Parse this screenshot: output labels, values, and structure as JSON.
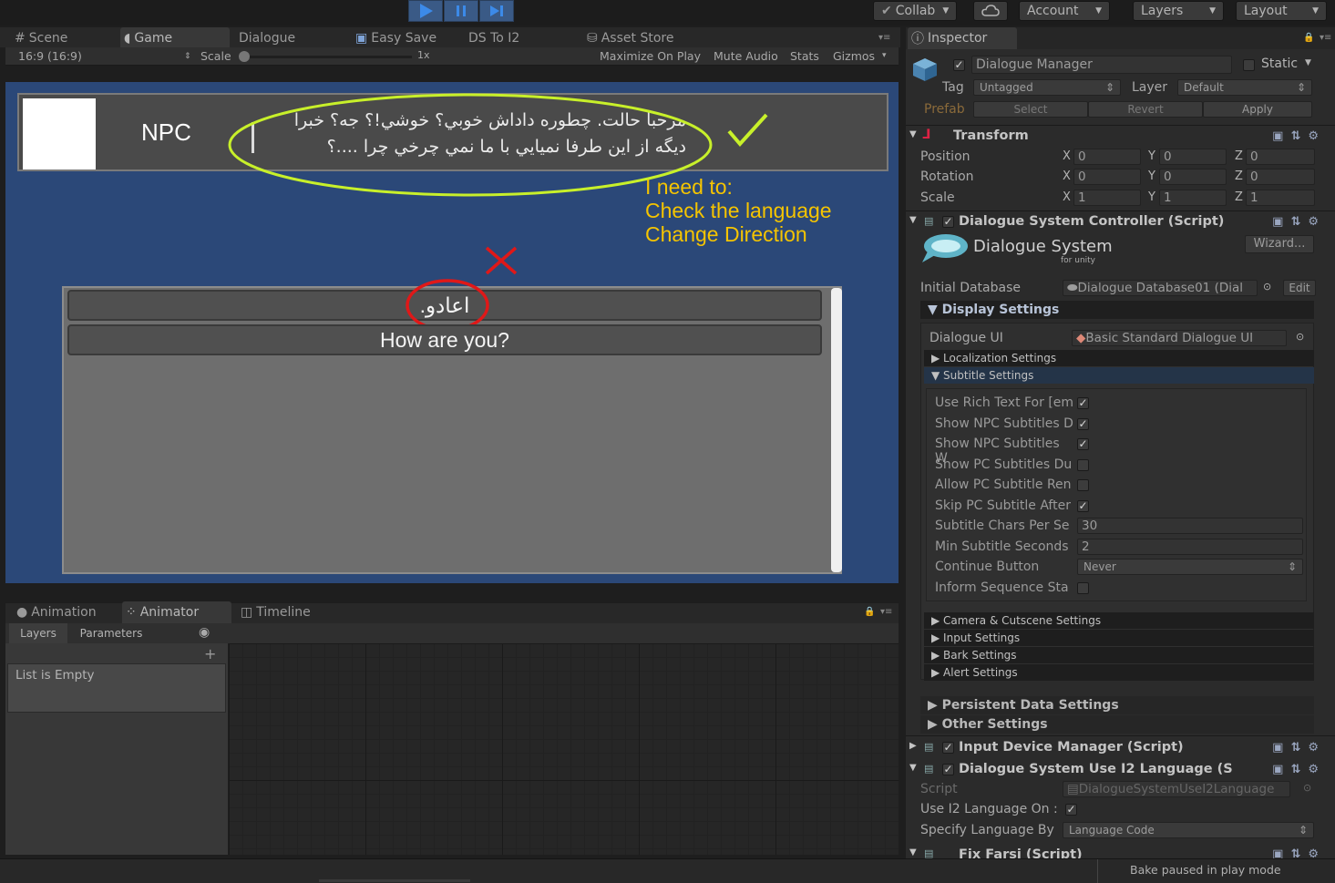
{
  "toolbar": {
    "collab": "Collab",
    "account": "Account",
    "layers": "Layers",
    "layout": "Layout"
  },
  "scene_tabs": [
    "Scene",
    "Game",
    "Dialogue",
    "Easy Save",
    "DS To I2",
    "Asset Store"
  ],
  "gamebar": {
    "aspect": "16:9 (16:9)",
    "scale_label": "Scale",
    "scale_value": "1x",
    "maximize": "Maximize On Play",
    "mute": "Mute Audio",
    "stats": "Stats",
    "gizmos": "Gizmos"
  },
  "game": {
    "npc_name": "NPC",
    "npc_line1": "مرحبا حالت. چطوره داداش خوبي؟ خوشي!؟ جه؟ خبرا",
    "npc_line2": "ديگه از اين طرفا نميايي با ما نمي چرخي چرا ....؟",
    "note_line1": "I need to:",
    "note_line2": "Check the language",
    "note_line3": "Change Direction",
    "response1": "اعادو.",
    "response2": "How are you?"
  },
  "animator": {
    "tabs": [
      "Animation",
      "Animator",
      "Timeline"
    ],
    "layers_tab": "Layers",
    "parameters_tab": "Parameters",
    "list_empty": "List is Empty"
  },
  "inspector": {
    "title": "Inspector",
    "object_name": "Dialogue Manager",
    "static": "Static",
    "tag_label": "Tag",
    "tag_value": "Untagged",
    "layer_label": "Layer",
    "layer_value": "Default",
    "prefab": "Prefab",
    "select": "Select",
    "revert": "Revert",
    "apply": "Apply",
    "transform": {
      "title": "Transform",
      "position": "Position",
      "rotation": "Rotation",
      "scale": "Scale",
      "pos": [
        "0",
        "0",
        "0"
      ],
      "rot": [
        "0",
        "0",
        "0"
      ],
      "scl": [
        "1",
        "1",
        "1"
      ]
    },
    "dsc": {
      "title": "Dialogue System Controller (Script)",
      "logo_main": "Dialogue System",
      "logo_sub": "for unity",
      "wizard": "Wizard...",
      "initial_db_label": "Initial Database",
      "initial_db_value": "Dialogue Database01 (Dial",
      "edit": "Edit",
      "display_settings": "Display Settings",
      "dialogue_ui_label": "Dialogue UI",
      "dialogue_ui_value": "Basic Standard Dialogue UI",
      "localization": "Localization Settings",
      "subtitle": "Subtitle Settings",
      "sub_rows": [
        {
          "label": "Use Rich Text For [em",
          "check": true
        },
        {
          "label": "Show NPC Subtitles D",
          "check": true
        },
        {
          "label": "Show NPC Subtitles W",
          "check": true
        },
        {
          "label": "Show PC Subtitles Du",
          "check": false
        },
        {
          "label": "Allow PC Subtitle Ren",
          "check": false
        },
        {
          "label": "Skip PC Subtitle After",
          "check": true
        }
      ],
      "chars_label": "Subtitle Chars Per Se",
      "chars_value": "30",
      "min_label": "Min Subtitle Seconds",
      "min_value": "2",
      "continue_label": "Continue Button",
      "continue_value": "Never",
      "inform_label": "Inform Sequence Sta",
      "camera": "Camera & Cutscene Settings",
      "input": "Input Settings",
      "bark": "Bark Settings",
      "alert": "Alert Settings",
      "persistent": "Persistent Data Settings",
      "other": "Other Settings"
    },
    "idm_title": "Input Device Manager (Script)",
    "dsui2": {
      "title": "Dialogue System Use I2 Language (S",
      "script_label": "Script",
      "script_value": "DialogueSystemUseI2Language",
      "use_label": "Use I2 Language On :",
      "specify_label": "Specify Language By",
      "specify_value": "Language Code"
    },
    "fix_farsi": "Fix Farsi (Script)"
  },
  "status": {
    "bake": "Bake paused in play mode"
  },
  "colors": {
    "game_bg": "#2b4878",
    "note_yellow": "#f5c400",
    "ellipse_green": "#c8f02a",
    "ellipse_red": "#e01818",
    "play_blue": "#3c8ae8"
  }
}
